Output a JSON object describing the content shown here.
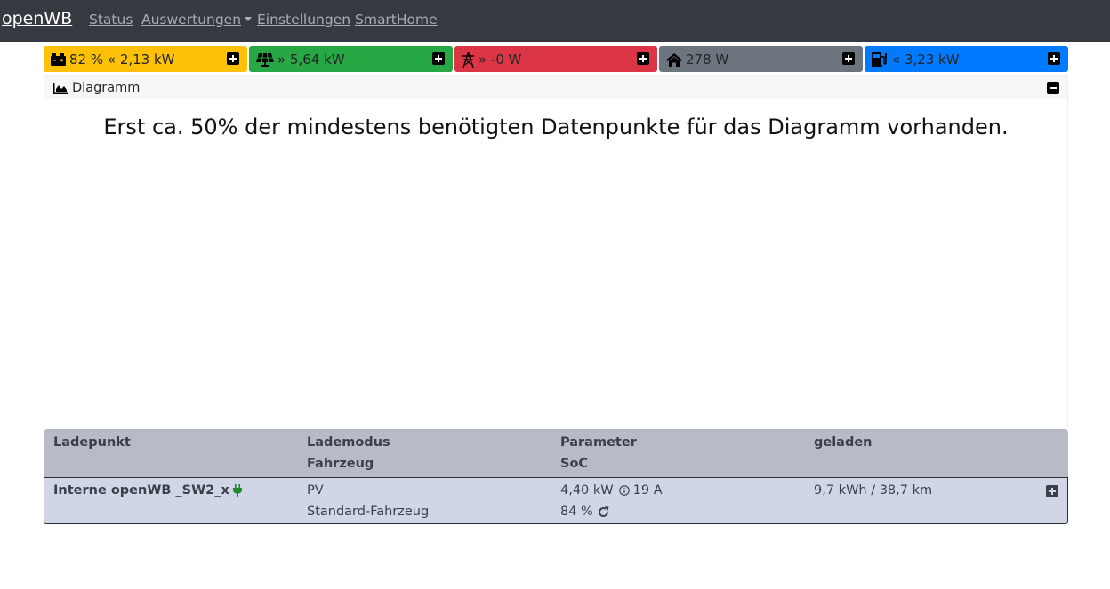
{
  "nav": {
    "brand": "openWB",
    "links": [
      "Status",
      "Auswertungen",
      "Einstellungen",
      "SmartHome"
    ]
  },
  "boxes": {
    "battery": {
      "icon": "car-battery-icon",
      "text": "82 % « 2,13 kW",
      "color": "#ffc107"
    },
    "pv": {
      "icon": "solar-panel-icon",
      "text": "» 5,64 kW",
      "color": "#28a745"
    },
    "grid": {
      "icon": "power-tower-icon",
      "text": "» -0 W",
      "color": "#dc3545"
    },
    "house": {
      "icon": "house-icon",
      "text": "278 W",
      "color": "#6c757d"
    },
    "charge": {
      "icon": "charging-station-icon",
      "text": "« 3,23 kW",
      "color": "#007bff"
    }
  },
  "diagram": {
    "title": "Diagramm",
    "message": "Erst ca. 50% der mindestens benötigten Datenpunkte für das Diagramm vorhanden."
  },
  "table": {
    "headers": {
      "ladepunkt": "Ladepunkt",
      "lademodus": "Lademodus",
      "fahrzeug": "Fahrzeug",
      "parameter": "Parameter",
      "soc": "SoC",
      "geladen": "geladen"
    },
    "row": {
      "name": "Interne openWB _SW2_x",
      "mode": "PV",
      "vehicle": "Standard-Fahrzeug",
      "power": "4,40 kW",
      "current": "19 A",
      "soc": "84 %",
      "charged": "9,7 kWh / 38,7 km"
    }
  }
}
